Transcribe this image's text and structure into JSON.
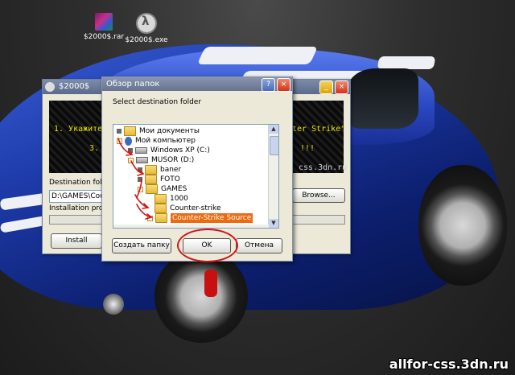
{
  "desktop": {
    "icons": [
      {
        "label": "$2000$.rar",
        "icon": "winrar-archive-icon"
      },
      {
        "label": "$2000$.exe",
        "icon": "half-life-exe-icon"
      }
    ],
    "watermark": "allfor-css.3dn.ru"
  },
  "installer": {
    "title": "$2000$",
    "banner_line1": "1. Укажите",
    "banner_line1_end": "nter Strike\"",
    "banner_line2": "3.",
    "banner_line2_end": "!!!",
    "banner_site": "css.3dn.ru",
    "destination_label": "Destination folder",
    "destination_value": "D:\\GAMES\\Coun",
    "browse_label": "Browse...",
    "progress_label": "Installation progress",
    "install_label": "Install"
  },
  "dialog": {
    "title": "Обзор папок",
    "prompt": "Select destination folder",
    "tree": [
      {
        "label": "Мои документы",
        "icon": "documents-icon",
        "expander": "collapsed"
      },
      {
        "label": "Мой компьютер",
        "icon": "computer-icon",
        "expander": "expanded"
      },
      {
        "label": "Windows XP (C:)",
        "icon": "drive-icon",
        "expander": "collapsed"
      },
      {
        "label": "MUSOR (D:)",
        "icon": "drive-icon",
        "expander": "expanded"
      },
      {
        "label": "baner",
        "icon": "folder-icon",
        "expander": "collapsed"
      },
      {
        "label": "FOTO",
        "icon": "folder-icon",
        "expander": "collapsed"
      },
      {
        "label": "GAMES",
        "icon": "folder-icon",
        "expander": "expanded"
      },
      {
        "label": "1000",
        "icon": "folder-icon",
        "expander": "none"
      },
      {
        "label": "Counter-strike",
        "icon": "folder-icon",
        "expander": "none"
      },
      {
        "label": "Counter-Strike Source",
        "icon": "folder-icon",
        "expander": "collapsed",
        "selected": true
      }
    ],
    "new_folder_label": "Создать папку",
    "ok_label": "OK",
    "cancel_label": "Отмена"
  },
  "colors": {
    "selection": "#ee6a10",
    "annotation_red": "#d01818",
    "banner_text": "#e6e300"
  }
}
